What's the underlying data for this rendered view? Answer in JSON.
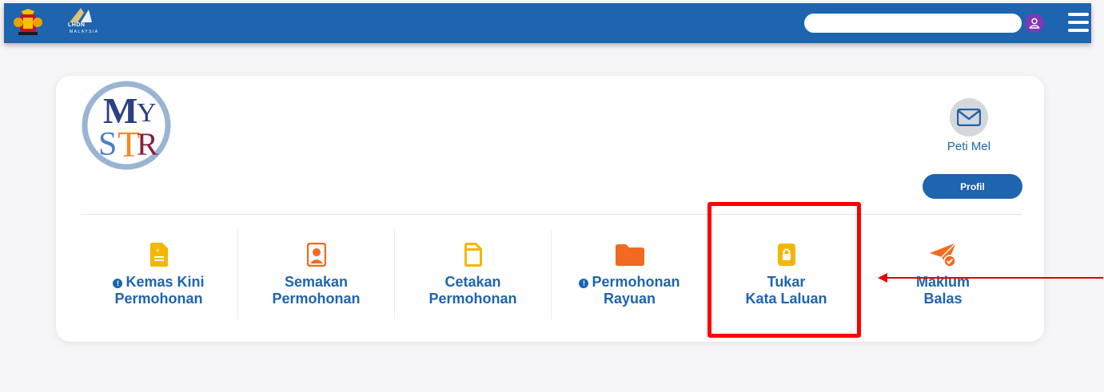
{
  "topbar": {
    "lhdn_logo_text": "LHDN",
    "lhdn_logo_sub": "MALAYSIA",
    "search_value": ""
  },
  "card": {
    "logo_text": "MySTR",
    "mail_label": "Peti Mel",
    "profile_label": "Profil"
  },
  "menu": [
    {
      "line1": "Kemas Kini",
      "line2": "Permohonan",
      "alert": true,
      "icon": "document-icon"
    },
    {
      "line1": "Semakan",
      "line2": "Permohonan",
      "alert": false,
      "icon": "user-file-icon"
    },
    {
      "line1": "Cetakan",
      "line2": "Permohonan",
      "alert": false,
      "icon": "file-icon"
    },
    {
      "line1": "Permohonan",
      "line2": "Rayuan",
      "alert": true,
      "icon": "folder-icon"
    },
    {
      "line1": "Tukar",
      "line2": "Kata Laluan",
      "alert": false,
      "icon": "lock-icon"
    },
    {
      "line1": "Maklum",
      "line2": "Balas",
      "alert": false,
      "icon": "send-check-icon"
    }
  ],
  "alert_glyph": "!",
  "colors": {
    "brand_blue": "#1e64ae",
    "accent_yellow": "#f2b705",
    "accent_orange": "#f26a21",
    "annotation_red": "#ff0000"
  }
}
